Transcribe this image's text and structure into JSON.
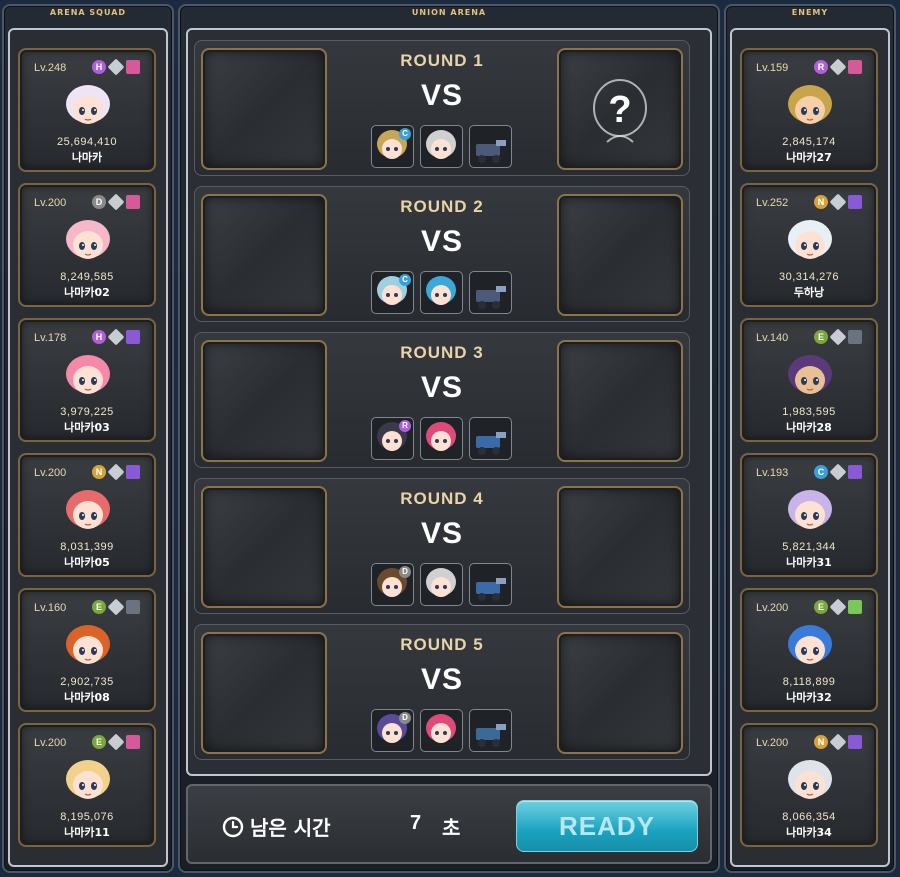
{
  "colors": {
    "panel_border": "#4d5866",
    "gold_border": "#8a7448",
    "ready_button": "#1aa3c0",
    "title_gold": "#e3c27a"
  },
  "squad": {
    "title": "ARENA SQUAD",
    "units": [
      {
        "level": "Lv.248",
        "badges": [
          {
            "t": "H",
            "c": "#b05fd8"
          },
          {
            "t": "",
            "c": "#c8cdd4",
            "shape": "diamond"
          },
          {
            "t": "",
            "c": "#d65a9a",
            "shape": "square"
          }
        ],
        "power": "25,694,410",
        "name": "나마카",
        "icon": "rabbit-ear-girl-portrait-icon",
        "hair": "#eee4f4",
        "skin": "#fde2d4"
      },
      {
        "level": "Lv.200",
        "badges": [
          {
            "t": "D",
            "c": "#8a8a8a"
          },
          {
            "t": "",
            "c": "#c8cdd4",
            "shape": "diamond"
          },
          {
            "t": "",
            "c": "#d65a9a",
            "shape": "square"
          }
        ],
        "power": "8,249,585",
        "name": "나마카02",
        "icon": "pink-bunny-hood-portrait-icon",
        "hair": "#f4b8c8",
        "skin": "#fde2d4"
      },
      {
        "level": "Lv.178",
        "badges": [
          {
            "t": "H",
            "c": "#b05fd8"
          },
          {
            "t": "",
            "c": "#c8cdd4",
            "shape": "diamond"
          },
          {
            "t": "",
            "c": "#8a5ad6",
            "shape": "square"
          }
        ],
        "power": "3,979,225",
        "name": "나마카03",
        "icon": "pink-hair-girl-portrait-icon",
        "hair": "#f58aa8",
        "skin": "#fde2d4"
      },
      {
        "level": "Lv.200",
        "badges": [
          {
            "t": "N",
            "c": "#d4a43a"
          },
          {
            "t": "",
            "c": "#c8cdd4",
            "shape": "diamond"
          },
          {
            "t": "",
            "c": "#8a5ad6",
            "shape": "square"
          }
        ],
        "power": "8,031,399",
        "name": "나마카05",
        "icon": "red-hair-girl-portrait-icon",
        "hair": "#e86a6a",
        "skin": "#fde2d4"
      },
      {
        "level": "Lv.160",
        "badges": [
          {
            "t": "E",
            "c": "#7aa83a"
          },
          {
            "t": "",
            "c": "#c8cdd4",
            "shape": "diamond"
          },
          {
            "t": "",
            "c": "#6a7480",
            "shape": "square"
          }
        ],
        "power": "2,902,735",
        "name": "나마카08",
        "icon": "orange-hair-boy-portrait-icon",
        "hair": "#d8642a",
        "skin": "#fde2d4"
      },
      {
        "level": "Lv.200",
        "badges": [
          {
            "t": "E",
            "c": "#7aa83a"
          },
          {
            "t": "",
            "c": "#c8cdd4",
            "shape": "diamond"
          },
          {
            "t": "",
            "c": "#d65a9a",
            "shape": "square"
          }
        ],
        "power": "8,195,076",
        "name": "나마카11",
        "icon": "santa-hat-girl-portrait-icon",
        "hair": "#f2d28a",
        "skin": "#fde2d4"
      }
    ]
  },
  "arena": {
    "title": "UNION ARENA",
    "rounds": [
      {
        "title": "ROUND 1",
        "vs": "VS",
        "enemy_revealed": false,
        "minis": [
          {
            "badge": "C",
            "bc": "#3aa0d8",
            "color": "#c7a65a"
          },
          {
            "badge": "",
            "bc": "",
            "color": "#d0d0d0"
          },
          {
            "badge": "",
            "bc": "",
            "color": "#4a5a78"
          }
        ]
      },
      {
        "title": "ROUND 2",
        "vs": "VS",
        "enemy_revealed": false,
        "minis": [
          {
            "badge": "C",
            "bc": "#3aa0d8",
            "color": "#9fd0e0"
          },
          {
            "badge": "",
            "bc": "",
            "color": "#3aa8d8"
          },
          {
            "badge": "",
            "bc": "",
            "color": "#4a5a78"
          }
        ]
      },
      {
        "title": "ROUND 3",
        "vs": "VS",
        "enemy_revealed": false,
        "minis": [
          {
            "badge": "R",
            "bc": "#b05fd8",
            "color": "#3a3a48"
          },
          {
            "badge": "",
            "bc": "",
            "color": "#e04a7a"
          },
          {
            "badge": "",
            "bc": "",
            "color": "#3a6aa8"
          }
        ]
      },
      {
        "title": "ROUND 4",
        "vs": "VS",
        "enemy_revealed": false,
        "minis": [
          {
            "badge": "D",
            "bc": "#8a8a8a",
            "color": "#6a4a2a"
          },
          {
            "badge": "",
            "bc": "",
            "color": "#d0d0d0"
          },
          {
            "badge": "",
            "bc": "",
            "color": "#3a6aa8"
          }
        ]
      },
      {
        "title": "ROUND 5",
        "vs": "VS",
        "enemy_revealed": false,
        "minis": [
          {
            "badge": "D",
            "bc": "#8a8a8a",
            "color": "#5a4a9a"
          },
          {
            "badge": "",
            "bc": "",
            "color": "#e04a7a"
          },
          {
            "badge": "",
            "bc": "",
            "color": "#3a6a98"
          }
        ]
      }
    ],
    "unknown_enemy_icon": "question-mark-silhouette-icon"
  },
  "enemy": {
    "title": "ENEMY",
    "units": [
      {
        "level": "Lv.159",
        "badges": [
          {
            "t": "R",
            "c": "#b05fd8"
          },
          {
            "t": "",
            "c": "#c8cdd4",
            "shape": "diamond"
          },
          {
            "t": "",
            "c": "#d65a9a",
            "shape": "square"
          }
        ],
        "power": "2,845,174",
        "name": "나마카27",
        "icon": "sunglasses-man-portrait-icon",
        "hair": "#c8a44a",
        "skin": "#f4cfa8"
      },
      {
        "level": "Lv.252",
        "badges": [
          {
            "t": "N",
            "c": "#d4a43a"
          },
          {
            "t": "",
            "c": "#c8cdd4",
            "shape": "diamond"
          },
          {
            "t": "",
            "c": "#8a5ad6",
            "shape": "square"
          }
        ],
        "power": "30,314,276",
        "name": "두하낭",
        "icon": "white-hair-boy-portrait-icon",
        "hair": "#e8f0f6",
        "skin": "#fde2d4"
      },
      {
        "level": "Lv.140",
        "badges": [
          {
            "t": "E",
            "c": "#7aa83a"
          },
          {
            "t": "",
            "c": "#c8cdd4",
            "shape": "diamond"
          },
          {
            "t": "",
            "c": "#6a7480",
            "shape": "square"
          }
        ],
        "power": "1,983,595",
        "name": "나마카28",
        "icon": "pirate-bandana-portrait-icon",
        "hair": "#5a3a7a",
        "skin": "#e8c094"
      },
      {
        "level": "Lv.193",
        "badges": [
          {
            "t": "C",
            "c": "#3aa0d8"
          },
          {
            "t": "",
            "c": "#c8cdd4",
            "shape": "diamond"
          },
          {
            "t": "",
            "c": "#8a5ad6",
            "shape": "square"
          }
        ],
        "power": "5,821,344",
        "name": "나마카31",
        "icon": "lavender-hair-portrait-icon",
        "hair": "#c8b4e8",
        "skin": "#fde2d4"
      },
      {
        "level": "Lv.200",
        "badges": [
          {
            "t": "E",
            "c": "#7aa83a"
          },
          {
            "t": "",
            "c": "#c8cdd4",
            "shape": "diamond"
          },
          {
            "t": "",
            "c": "#7ac85a",
            "shape": "square"
          }
        ],
        "power": "8,118,899",
        "name": "나마카32",
        "icon": "blue-cap-portrait-icon",
        "hair": "#3a7ad8",
        "skin": "#fde2d4"
      },
      {
        "level": "Lv.200",
        "badges": [
          {
            "t": "N",
            "c": "#d4a43a"
          },
          {
            "t": "",
            "c": "#c8cdd4",
            "shape": "diamond"
          },
          {
            "t": "",
            "c": "#8a5ad6",
            "shape": "square"
          }
        ],
        "power": "8,066,354",
        "name": "나마카34",
        "icon": "silver-hair-man-portrait-icon",
        "hair": "#e0e4ea",
        "skin": "#fde2d4"
      }
    ]
  },
  "footer": {
    "time_label": "남은 시간",
    "time_value": "7",
    "time_unit": "초",
    "ready_label": "READY"
  }
}
